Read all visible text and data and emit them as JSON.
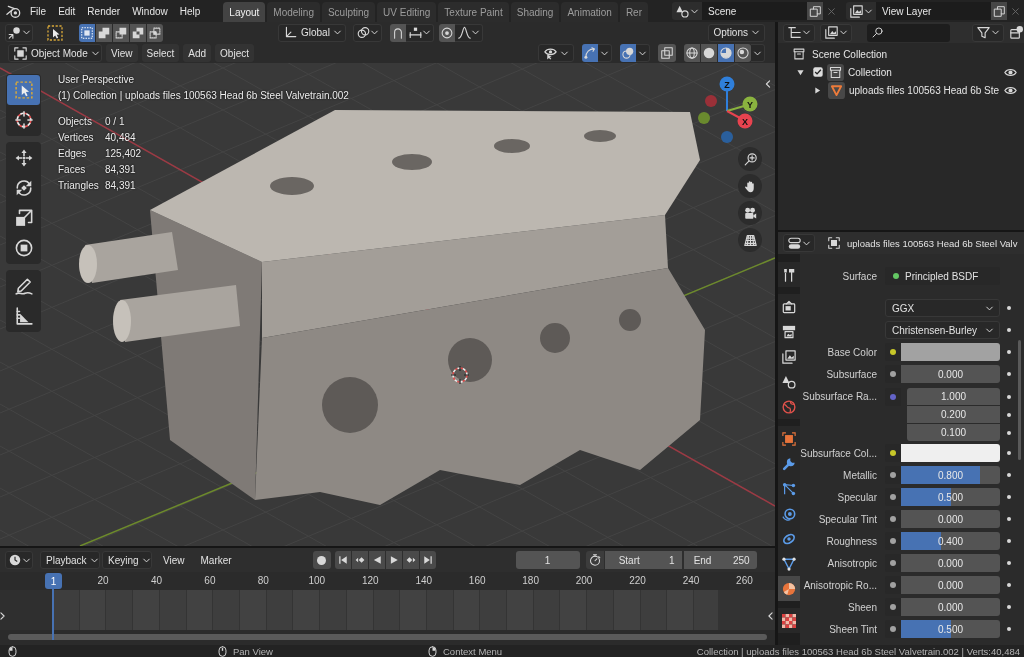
{
  "topbar": {
    "menus": [
      "File",
      "Edit",
      "Render",
      "Window",
      "Help"
    ],
    "workspaces": [
      {
        "label": "Layout",
        "selected": true
      },
      {
        "label": "Modeling",
        "selected": false
      },
      {
        "label": "Sculpting",
        "selected": false
      },
      {
        "label": "UV Editing",
        "selected": false
      },
      {
        "label": "Texture Paint",
        "selected": false
      },
      {
        "label": "Shading",
        "selected": false
      },
      {
        "label": "Animation",
        "selected": false
      },
      {
        "label": "Rer",
        "selected": false
      }
    ],
    "scene": {
      "value": "Scene"
    },
    "view_layer": {
      "value": "View Layer"
    }
  },
  "viewport": {
    "tool_header": {
      "select_modes": [
        {
          "selected": true
        },
        {
          "selected": false
        },
        {
          "selected": false
        },
        {
          "selected": false
        },
        {
          "selected": false
        }
      ],
      "orientation": "Global",
      "snap": {
        "on": false
      },
      "proportional": {
        "on": false
      },
      "options": "Options"
    },
    "header": {
      "mode": "Object Mode",
      "menus": [
        "View",
        "Select",
        "Add",
        "Object"
      ],
      "gizmos": {
        "on": true
      },
      "overlays": {
        "on": true
      },
      "xray": {
        "on": false
      },
      "shading": [
        {
          "selected": false
        },
        {
          "selected": false
        },
        {
          "selected": true
        },
        {
          "selected": false
        }
      ]
    },
    "tools": [
      {
        "selected": true
      },
      {
        "selected": false
      },
      {
        "selected": false
      },
      {
        "selected": false
      },
      {
        "selected": false
      },
      {
        "selected": false
      },
      {
        "selected": false
      },
      {
        "selected": false
      }
    ],
    "info": {
      "view": "User Perspective",
      "context": "(1) Collection | uploads files 100563 Head 6b Steel Valvetrain.002",
      "stats": [
        {
          "label": "Objects",
          "value": "0 / 1"
        },
        {
          "label": "Vertices",
          "value": "40,484"
        },
        {
          "label": "Edges",
          "value": "125,402"
        },
        {
          "label": "Faces",
          "value": "84,391"
        },
        {
          "label": "Triangles",
          "value": "84,391"
        }
      ]
    },
    "axes": [
      "Z",
      "Y",
      "X"
    ]
  },
  "outliner": {
    "tree": [
      {
        "kind": "scene_collection",
        "label": "Scene Collection",
        "children": [
          {
            "kind": "collection",
            "label": "Collection",
            "expanded": true,
            "checked": true,
            "visible": true,
            "children": [
              {
                "kind": "object",
                "label": "uploads files 100563 Head 6b Ste",
                "expanded": false,
                "visible": true
              }
            ]
          }
        ]
      }
    ]
  },
  "properties": {
    "object_name": "uploads files 100563 Head 6b Steel Valv",
    "tabs": [
      {
        "selected": false
      },
      {
        "selected": false
      },
      {
        "selected": false
      },
      {
        "selected": false
      },
      {
        "selected": false
      },
      {
        "selected": false
      },
      {
        "selected": false
      },
      {
        "selected": false
      },
      {
        "selected": false
      },
      {
        "selected": false
      },
      {
        "selected": false
      },
      {
        "selected": false
      },
      {
        "selected": true
      },
      {
        "selected": false
      }
    ],
    "rows": [
      {
        "kind": "shader",
        "label": "Surface",
        "value": "Principled BSDF"
      },
      {
        "kind": "dropdown",
        "value": "GGX"
      },
      {
        "kind": "dropdown",
        "value": "Christensen-Burley"
      },
      {
        "kind": "color",
        "label": "Base Color",
        "color": "#a2a2a2"
      },
      {
        "kind": "number",
        "label": "Subsurface",
        "value": "0.000"
      },
      {
        "kind": "vector",
        "label": "Subsurface Ra...",
        "values": [
          "1.000",
          "0.200",
          "0.100"
        ]
      },
      {
        "kind": "color",
        "label": "Subsurface Col...",
        "color": "#efefef"
      },
      {
        "kind": "number",
        "label": "Metallic",
        "value": "0.800",
        "level": 0.8
      },
      {
        "kind": "number",
        "label": "Specular",
        "value": "0.500",
        "level": 0.5
      },
      {
        "kind": "number",
        "label": "Specular Tint",
        "value": "0.000"
      },
      {
        "kind": "number",
        "label": "Roughness",
        "value": "0.400",
        "level": 0.4
      },
      {
        "kind": "number",
        "label": "Anisotropic",
        "value": "0.000"
      },
      {
        "kind": "number",
        "label": "Anisotropic Ro...",
        "value": "0.000"
      },
      {
        "kind": "number",
        "label": "Sheen",
        "value": "0.000"
      },
      {
        "kind": "number",
        "label": "Sheen Tint",
        "value": "0.500",
        "level": 0.5
      }
    ]
  },
  "timeline": {
    "menus": [
      {
        "kind": "dropdown",
        "label": "Playback"
      },
      {
        "kind": "dropdown",
        "label": "Keying"
      },
      {
        "kind": "menu",
        "label": "View"
      },
      {
        "kind": "menu",
        "label": "Marker"
      }
    ],
    "frame": "1",
    "start": {
      "label": "Start",
      "value": "1"
    },
    "end": {
      "label": "End",
      "value": "250"
    },
    "playhead": "1",
    "ticks": [
      "20",
      "40",
      "60",
      "80",
      "100",
      "120",
      "140",
      "160",
      "180",
      "200",
      "220",
      "240",
      "260"
    ]
  },
  "status_bar": {
    "hints": [
      "Pan View",
      "Context Menu"
    ],
    "stats": "Collection | uploads files 100563 Head 6b Steel Valvetrain.002 | Verts:40,484"
  }
}
